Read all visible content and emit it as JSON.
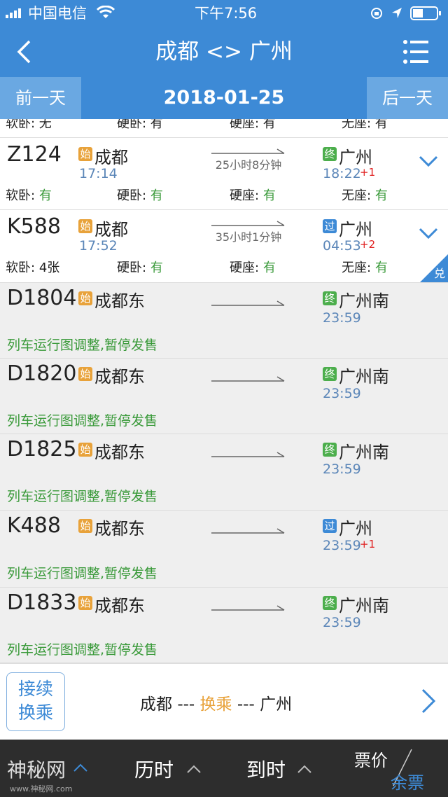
{
  "status": {
    "carrier": "中国电信",
    "time": "下午7:56"
  },
  "nav": {
    "title": "成都 <> 广州"
  },
  "datebar": {
    "prev": "前一天",
    "date": "2018-01-25",
    "next": "后一天"
  },
  "partial_row": {
    "soft": "软卧: 无",
    "hard": "硬卧: 有",
    "seat": "硬座: 有",
    "stand": "无座: 有"
  },
  "labels": {
    "soft": "软卧:",
    "hard": "硬卧:",
    "seat": "硬座:",
    "stand": "无座:"
  },
  "trains": [
    {
      "no": "Z124",
      "from_badge": "始",
      "from": "成都",
      "dep": "17:14",
      "duration": "25小时8分钟",
      "to_badge": "终",
      "to": "广州",
      "arr": "18:22",
      "plus": "+1",
      "soft": "有",
      "hard": "有",
      "seat": "有",
      "stand": "有"
    },
    {
      "no": "K588",
      "from_badge": "始",
      "from": "成都",
      "dep": "17:52",
      "duration": "35小时1分钟",
      "to_badge": "过",
      "to": "广州",
      "arr": "04:53",
      "plus": "+2",
      "soft": "4张",
      "hard": "有",
      "seat": "有",
      "stand": "有",
      "corner": "兑"
    },
    {
      "no": "D1804",
      "from_badge": "始",
      "from": "成都东",
      "to_badge": "终",
      "to": "广州南",
      "arr": "23:59",
      "msg": "列车运行图调整,暂停发售"
    },
    {
      "no": "D1820",
      "from_badge": "始",
      "from": "成都东",
      "to_badge": "终",
      "to": "广州南",
      "arr": "23:59",
      "msg": "列车运行图调整,暂停发售"
    },
    {
      "no": "D1825",
      "from_badge": "始",
      "from": "成都东",
      "to_badge": "终",
      "to": "广州南",
      "arr": "23:59",
      "msg": "列车运行图调整,暂停发售"
    },
    {
      "no": "K488",
      "from_badge": "始",
      "from": "成都东",
      "to_badge": "过",
      "to": "广州",
      "arr": "23:59",
      "plus": "+1",
      "msg": "列车运行图调整,暂停发售"
    },
    {
      "no": "D1833",
      "from_badge": "始",
      "from": "成都东",
      "to_badge": "终",
      "to": "广州南",
      "arr": "23:59",
      "msg": "列车运行图调整,暂停发售"
    }
  ],
  "transfer": {
    "btn_line1": "接续",
    "btn_line2": "换乘",
    "from": "成都",
    "sep1": "---",
    "mid": "换乘",
    "sep2": "---",
    "to": "广州"
  },
  "bottom": {
    "left": "神秘网",
    "duration": "历时",
    "arrival": "到时",
    "price": "票价",
    "tickets": "余票"
  },
  "watermark": "www.神秘网.com",
  "colors": {
    "primary": "#3d8ad6",
    "badge_start": "#e8a23a",
    "badge_end": "#4cae4c",
    "badge_pass": "#3d8ad6",
    "green_text": "#3a9a3a",
    "orange_text": "#e8a23a"
  }
}
